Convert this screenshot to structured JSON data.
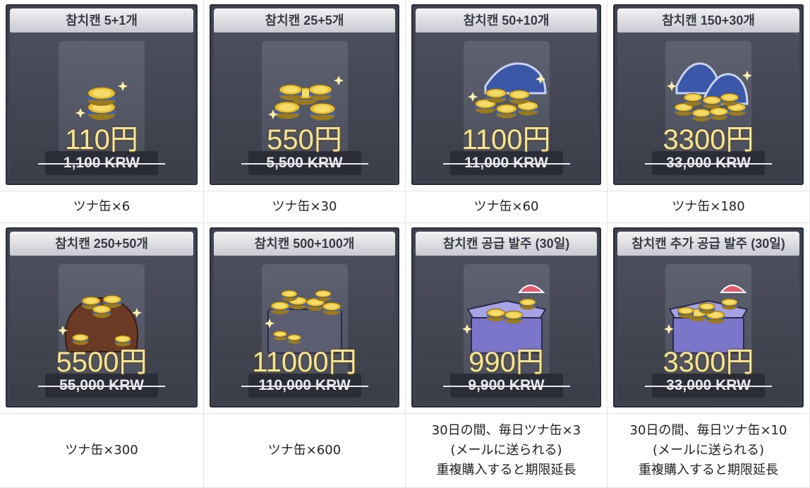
{
  "items": [
    {
      "card_title": "참치캔 5+1개",
      "jpy_price": "110円",
      "krw_price": "1,100 KRW",
      "description": [
        "ツナ缶×6"
      ],
      "art": "tuna-cans-small-icon"
    },
    {
      "card_title": "참치캔 25+5개",
      "jpy_price": "550円",
      "krw_price": "5,500 KRW",
      "description": [
        "ツナ缶×30"
      ],
      "art": "tuna-cans-stack-icon"
    },
    {
      "card_title": "참치캔 50+10개",
      "jpy_price": "1100円",
      "krw_price": "11,000 KRW",
      "description": [
        "ツナ缶×60"
      ],
      "art": "tuna-cans-wave-icon"
    },
    {
      "card_title": "참치캔 150+30개",
      "jpy_price": "3300円",
      "krw_price": "33,000 KRW",
      "description": [
        "ツナ缶×180"
      ],
      "art": "tuna-cans-pile-icon"
    },
    {
      "card_title": "참치캔 250+50개",
      "jpy_price": "5500円",
      "krw_price": "55,000 KRW",
      "description": [
        "ツナ缶×300"
      ],
      "art": "tuna-cans-sack-icon"
    },
    {
      "card_title": "참치캔 500+100개",
      "jpy_price": "11000円",
      "krw_price": "110,000 KRW",
      "description": [
        "ツナ缶×600"
      ],
      "art": "tuna-cans-crate-icon"
    },
    {
      "card_title": "참치캔 공급 발주 (30일)",
      "jpy_price": "990円",
      "krw_price": "9,900 KRW",
      "description": [
        "30日の間、毎日ツナ缶×3",
        "(メールに送られる)",
        "重複購入すると期限延長"
      ],
      "art": "supply-box-parachute-icon"
    },
    {
      "card_title": "참치캔 추가 공급 발주 (30일)",
      "jpy_price": "3300円",
      "krw_price": "33,000 KRW",
      "description": [
        "30日の間、毎日ツナ缶×10",
        "(メールに送られる)",
        "重複購入すると期限延長"
      ],
      "art": "supply-box-parachute-large-icon"
    }
  ],
  "colors": {
    "card_bg": "#3f4250",
    "title_bar": "#d8d9de",
    "jpy_text": "#f4e39c",
    "tuna_gold": "#e8c23a",
    "tuna_blue": "#3e63b5",
    "crate_purple": "#7b76c9"
  }
}
